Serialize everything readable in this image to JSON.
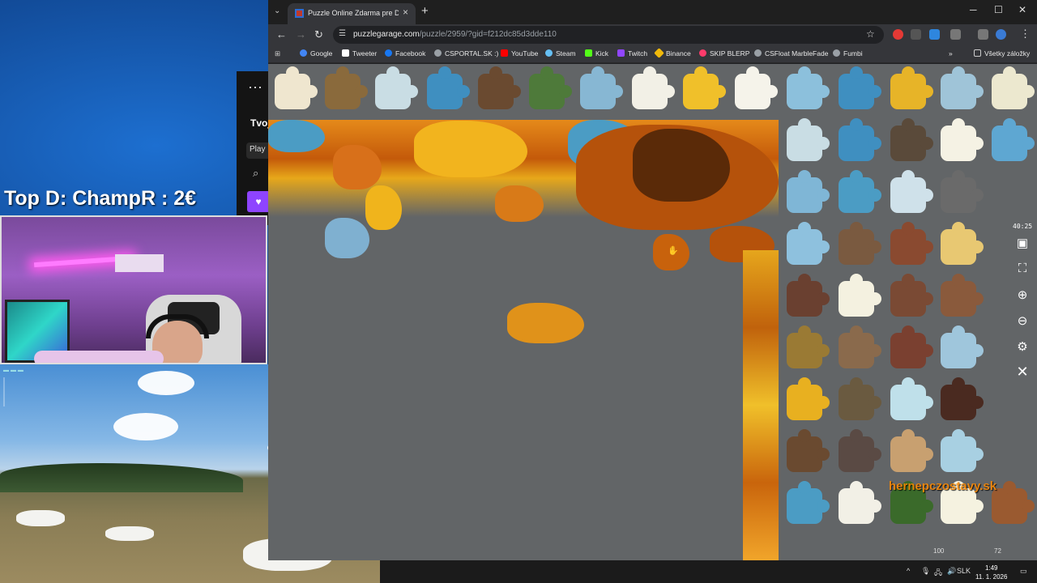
{
  "overlay": {
    "donation_text": "Top D: ChampR : 2€"
  },
  "background_app": {
    "more_label": "⋯",
    "title_partial": "Tvoj",
    "play_partial": "Play"
  },
  "browser": {
    "tab": {
      "title": "Puzzle Online Zdarma pre Dosp...",
      "close": "×"
    },
    "new_tab": "+",
    "window_controls": {
      "minimize": "─",
      "maximize": "☐",
      "close": "✕"
    },
    "url": {
      "host": "puzzlegarage.com",
      "path": "/puzzle/2959/?gid=f212dc85d3dde110"
    },
    "bookmarks": [
      {
        "label": "Google",
        "color": "#4285f4"
      },
      {
        "label": "Tweeter",
        "color": "#ffffff"
      },
      {
        "label": "Facebook",
        "color": "#1877f2"
      },
      {
        "label": "CSPORTAL.SK :)",
        "color": "#9aa0a6"
      },
      {
        "label": "YouTube",
        "color": "#ff0000"
      },
      {
        "label": "Steam",
        "color": "#66c0f4"
      },
      {
        "label": "Kick",
        "color": "#53fc18"
      },
      {
        "label": "Twitch",
        "color": "#9146ff"
      },
      {
        "label": "Binance",
        "color": "#f0b90b"
      },
      {
        "label": "SKIP BLERP",
        "color": "#ff3b6b"
      },
      {
        "label": "CSFloat MarbleFade",
        "color": "#9aa0a6"
      },
      {
        "label": "Fumbi",
        "color": "#9aa0a6"
      }
    ],
    "all_bookmarks": "Všetky záložky"
  },
  "puzzle": {
    "timer": "40:25",
    "status_left": "100",
    "status_right": "72",
    "watermark": "hernepczostavy.sk"
  },
  "taskbar": {
    "lang": "SLK",
    "time": "1:49",
    "date": "11. 1. 2026"
  },
  "colors": {
    "sky": "#4b9cc4",
    "leaf_gold": "#f0b41c",
    "leaf_orange": "#c8620c",
    "board": "#626567"
  }
}
